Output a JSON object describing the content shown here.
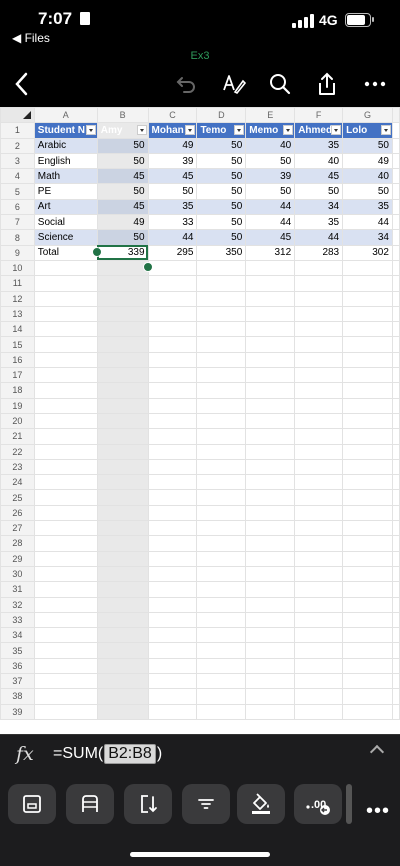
{
  "status": {
    "time": "7:07",
    "back_app": "◀ Files",
    "network": "4G"
  },
  "file_name": "Ex3",
  "icons": {
    "back": "chevron-left-icon",
    "undo": "undo-icon",
    "draw": "draw-pen-icon",
    "search": "search-icon",
    "share": "share-icon",
    "more": "more-icon"
  },
  "columns": [
    "A",
    "B",
    "C",
    "D",
    "E",
    "F",
    "G"
  ],
  "row_numbers": [
    "1",
    "2",
    "3",
    "4",
    "5",
    "6",
    "7",
    "8",
    "9",
    "10",
    "11",
    "12",
    "13",
    "14",
    "15",
    "16",
    "17",
    "18",
    "19",
    "20",
    "21",
    "22",
    "23",
    "24",
    "25",
    "26",
    "27",
    "28",
    "29",
    "30",
    "31",
    "32",
    "33",
    "34",
    "35",
    "36",
    "37",
    "38",
    "39"
  ],
  "headers": [
    "Student N",
    "Amy",
    "Mohan",
    "Temo",
    "Memo",
    "Ahmed",
    "Lolo"
  ],
  "rows": [
    [
      "Arabic",
      "50",
      "49",
      "50",
      "40",
      "35",
      "50"
    ],
    [
      "English",
      "50",
      "39",
      "50",
      "50",
      "40",
      "49"
    ],
    [
      "Math",
      "45",
      "45",
      "50",
      "39",
      "45",
      "40"
    ],
    [
      "PE",
      "50",
      "50",
      "50",
      "50",
      "50",
      "50"
    ],
    [
      "Art",
      "45",
      "35",
      "50",
      "44",
      "34",
      "35"
    ],
    [
      "Social",
      "49",
      "33",
      "50",
      "44",
      "35",
      "44"
    ],
    [
      "Science",
      "50",
      "44",
      "50",
      "45",
      "44",
      "34"
    ]
  ],
  "total_row": [
    "Total",
    "339",
    "295",
    "350",
    "312",
    "283",
    "302"
  ],
  "formula": {
    "fx": "fx",
    "prefix": "=SUM(",
    "range": "B2:B8",
    "suffix": ")"
  },
  "colors": {
    "header_blue": "#4472c4",
    "band_blue": "#d9e1f2",
    "selection_green": "#217346",
    "accent_green": "#2e9a5b"
  },
  "ribbon": {
    "buttons": [
      "cell-format-icon",
      "table-rows-icon",
      "sort-icon",
      "filter-icon",
      "fill-color-icon",
      "decimal-places-icon"
    ],
    "more": "•••"
  }
}
